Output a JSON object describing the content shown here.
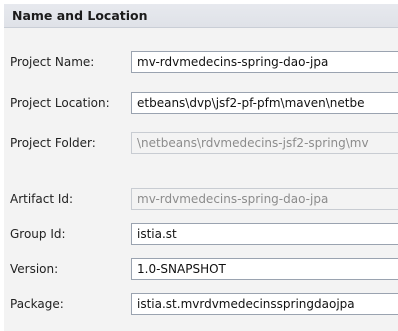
{
  "section": {
    "title": "Name and Location"
  },
  "fields": {
    "project_name": {
      "label": "Project Name:",
      "value": "mv-rdvmedecins-spring-dao-jpa"
    },
    "project_location": {
      "label": "Project Location:",
      "value": "etbeans\\dvp\\jsf2-pf-pfm\\maven\\netbe"
    },
    "project_folder": {
      "label": "Project Folder:",
      "value": "\\netbeans\\rdvmedecins-jsf2-spring\\mv"
    },
    "artifact_id": {
      "label": "Artifact Id:",
      "value": "mv-rdvmedecins-spring-dao-jpa"
    },
    "group_id": {
      "label": "Group Id:",
      "value": "istia.st"
    },
    "version": {
      "label": "Version:",
      "value": "1.0-SNAPSHOT"
    },
    "package": {
      "label": "Package:",
      "value": "istia.st.mvrdvmedecinsspringdaojpa"
    }
  }
}
